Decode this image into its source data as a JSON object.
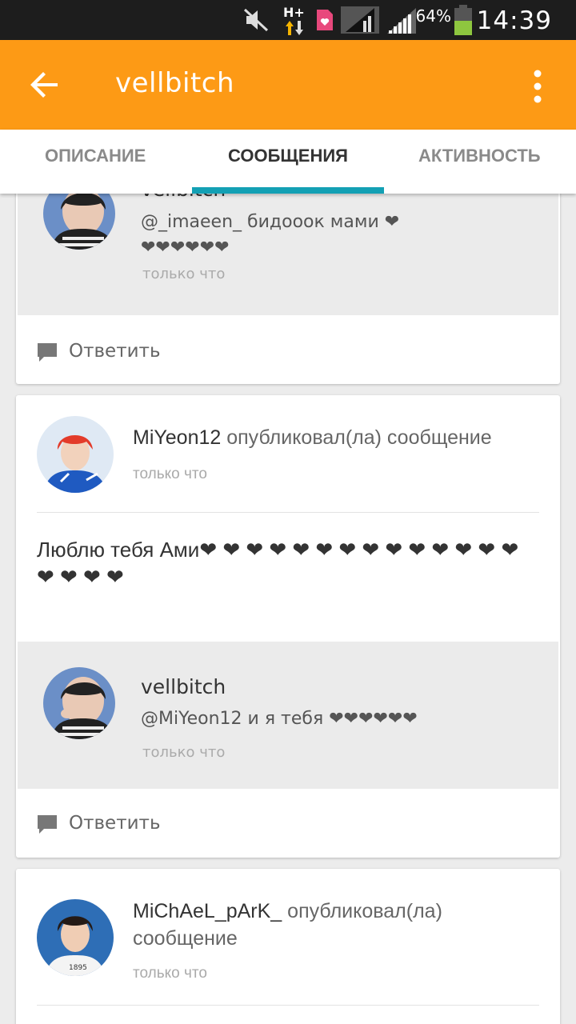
{
  "status_bar": {
    "network": "H+",
    "battery_percent": "64%",
    "time": "14:39",
    "icons": [
      "mute-icon",
      "network-arrows-icon",
      "sim-card-icon",
      "signal-icon",
      "signal-icon",
      "battery-icon"
    ]
  },
  "app_bar": {
    "title": "vellbitch",
    "back_icon": "arrow-left-icon",
    "menu_icon": "more-vert-icon"
  },
  "tabs": [
    {
      "label": "ОПИСАНИЕ",
      "active": false
    },
    {
      "label": "СООБЩЕНИЯ",
      "active": true
    },
    {
      "label": "АКТИВНОСТЬ",
      "active": false
    }
  ],
  "accent_color": "#fd9a15",
  "tab_indicator_color": "#13a0b4",
  "cards": [
    {
      "reply": {
        "username": "vellbitch",
        "text": "@_imaeen_ бидооок мами ❤❤❤❤❤❤❤",
        "time": "только что"
      },
      "reply_action": "Ответить"
    },
    {
      "author": "MiYeon12",
      "action_text": "опубликовал(ла) сообщение",
      "time": "только что",
      "body": "Люблю тебя Ами❤ ❤ ❤ ❤ ❤ ❤ ❤ ❤ ❤ ❤ ❤ ❤ ❤ ❤ ❤ ❤ ❤ ❤",
      "reply": {
        "username": "vellbitch",
        "text": "@MiYeon12 и я тебя ❤❤❤❤❤❤",
        "time": "только что"
      },
      "reply_action": "Ответить"
    },
    {
      "author": "MiChAeL_pArK_",
      "action_text": "опубликовал(ла) сообщение",
      "time": "только что"
    }
  ]
}
